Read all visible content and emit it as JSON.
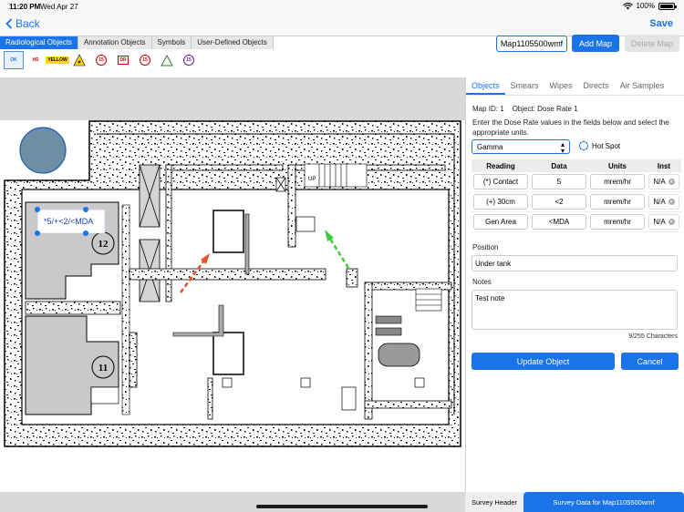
{
  "status": {
    "time": "11:20 PM",
    "date": "Wed Apr 27",
    "battery": "100%"
  },
  "nav": {
    "back": "Back",
    "save": "Save"
  },
  "tool_tabs": [
    "Radiological Objects",
    "Annotation Objects",
    "Symbols",
    "User-Defined Objects"
  ],
  "symbols": [
    "OK",
    "HS",
    "YELLOW",
    "RAD",
    "15",
    "DR",
    "15",
    "DR",
    "15"
  ],
  "map_controls": {
    "map_id": "Map1105500wmf",
    "add_map": "Add Map",
    "delete_map": "Delete Map"
  },
  "map": {
    "annotation": "*5/+<2/<MDA",
    "room_numbers": [
      "12",
      "11"
    ],
    "stair_label": "UP"
  },
  "panel": {
    "tabs": [
      "Objects",
      "Smears",
      "Wipes",
      "Directs",
      "Air Samples"
    ],
    "map_info": "Map ID: 1    Object: Dose Rate 1",
    "instruction": "Enter the Dose Rate values in the fields below and select the appropriate units.",
    "type_value": "Gamma",
    "hot_spot": "Hot Spot",
    "table_headers": [
      "Reading",
      "Data",
      "Units",
      "Inst"
    ],
    "rows": [
      {
        "reading": "(*) Contact",
        "data": "5",
        "units": "mrem/hr",
        "inst": "N/A"
      },
      {
        "reading": "(+) 30cm",
        "data": "<2",
        "units": "mrem/hr",
        "inst": "N/A"
      },
      {
        "reading": "Gen Area",
        "data": "<MDA",
        "units": "mrem/hr",
        "inst": "N/A"
      }
    ],
    "position_label": "Position",
    "position_value": "Under tank",
    "notes_label": "Notes",
    "notes_value": "Test note",
    "char_count": "9/255 Characters",
    "update": "Update Object",
    "cancel": "Cancel"
  },
  "bottom_tabs": {
    "header": "Survey Header",
    "survey": "Survey Data for Map1105500wmf"
  },
  "colors": {
    "accent": "#1a73e8",
    "arrow_red": "#e8502a",
    "arrow_green": "#3ccc3c"
  }
}
